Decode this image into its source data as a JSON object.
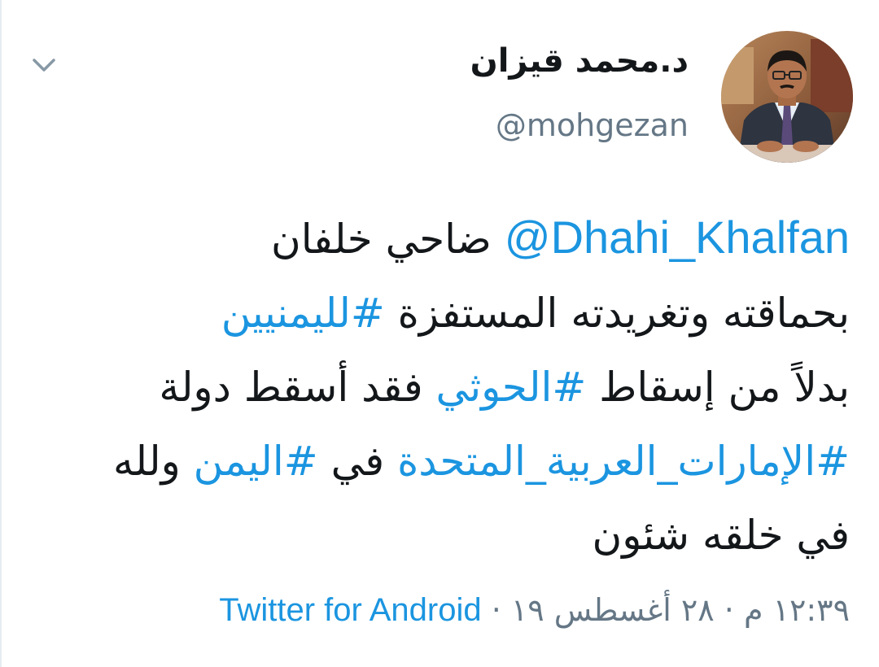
{
  "tweet": {
    "display_name": "د.محمد قيزان",
    "handle": "@mohgezan",
    "avatar_icon": "avatar-photo",
    "menu_icon": "chevron-down-icon",
    "lines": [
      {
        "mention": "@Dhahi_Khalfan",
        "text": " ضاحي خلفان"
      },
      {
        "text": "بحماقته وتغريدته المستفزة ",
        "hashtag": "#لليمنيين"
      },
      {
        "text1": "بدلاً من إسقاط ",
        "hashtag": "#الحوثي",
        "text2": " فقد أسقط دولة"
      },
      {
        "hashtag1": "#الإمارات_العربية_المتحدة",
        "text1": " في ",
        "hashtag2": "#اليمن",
        "text2": " ولله"
      },
      {
        "text": "في خلقه شئون"
      }
    ],
    "timestamp": "١٢:٣٩ م",
    "separator": "·",
    "date": "٢٨ أغسطس ١٩",
    "source": "Twitter for Android",
    "colors": {
      "link": "#1b95e0",
      "secondary": "#657786",
      "text": "#14171a"
    }
  }
}
